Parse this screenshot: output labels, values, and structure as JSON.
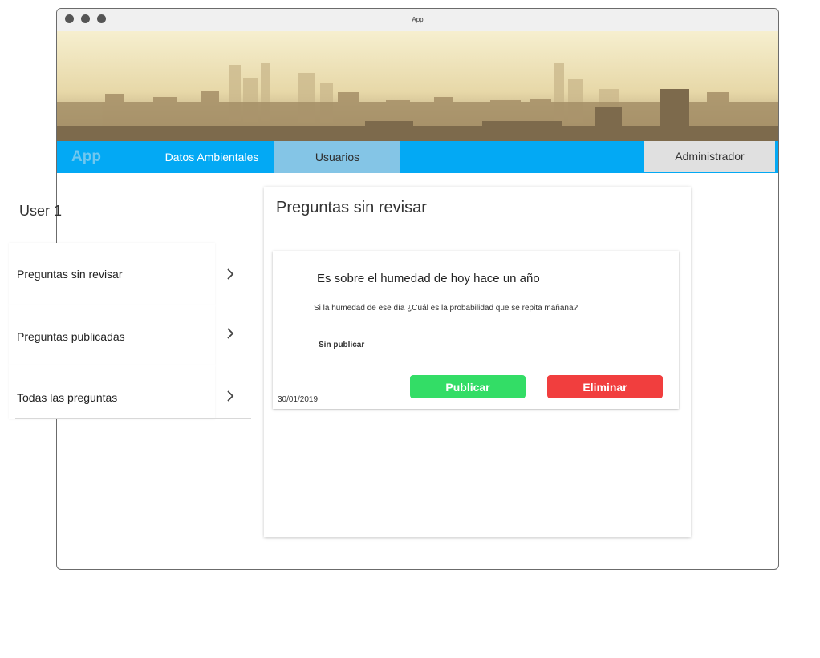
{
  "window": {
    "title": "App"
  },
  "navbar": {
    "brand": "App",
    "tabs": [
      {
        "label": "Datos Ambientales"
      },
      {
        "label": "Usuarios"
      }
    ],
    "admin_label": "Administrador"
  },
  "sidebar": {
    "user": "User 1",
    "items": [
      {
        "label": "Preguntas sin revisar"
      },
      {
        "label": "Preguntas publicadas"
      },
      {
        "label": "Todas las preguntas"
      }
    ]
  },
  "main": {
    "title": "Preguntas sin revisar",
    "question": {
      "title": "Es sobre el humedad de hoy hace un año",
      "body": "Si la humedad de ese día ¿Cuál es la probabilidad que se repita mañana?",
      "status": "Sin publicar",
      "date": "30/01/2019",
      "publish_label": "Publicar",
      "delete_label": "Eliminar"
    }
  }
}
